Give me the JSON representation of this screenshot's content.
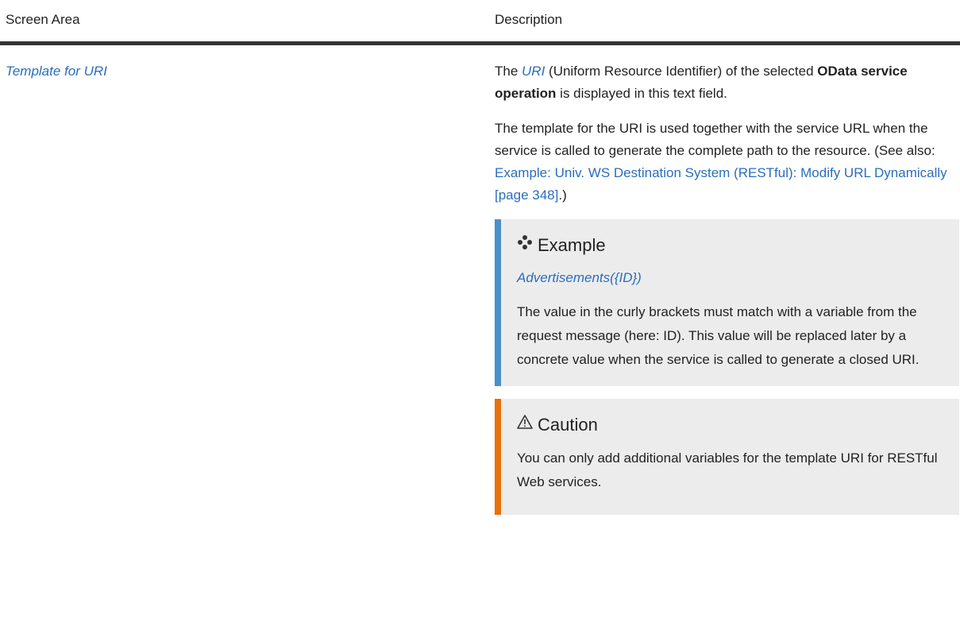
{
  "table": {
    "headers": [
      "Screen Area",
      "Description"
    ]
  },
  "row": {
    "label": "Template for URI",
    "desc_p1": {
      "t1": "The ",
      "uri": "URI",
      "t2": " (Uniform Resource Identifier) of the selected ",
      "b1": "OData service operation",
      "t3": " is displayed in this text field."
    },
    "desc_p2": {
      "t1": "The template for the URI is used together with the service URL when the service is called to generate the complete path to the resource. (See also: ",
      "link": "Example: Univ. WS Destination System (RESTful): Modify URL Dynamically [page 348]",
      "t2": ".)"
    },
    "example": {
      "icon": "example-icon",
      "title": "Example",
      "code": "Advertisements({ID})",
      "text": "The value in the curly brackets must match with a variable from the request message (here: ID). This value will be replaced later by a concrete value when the service is called to generate a closed URI."
    },
    "caution": {
      "icon": "warning-icon",
      "title": "Caution",
      "text": "You can only add additional variables for the template URI for RESTful Web services."
    }
  },
  "colors": {
    "link": "#2a6ebb",
    "example_bar": "#4a90c8",
    "caution_bar": "#e8700a",
    "note_bg": "#ececec"
  }
}
